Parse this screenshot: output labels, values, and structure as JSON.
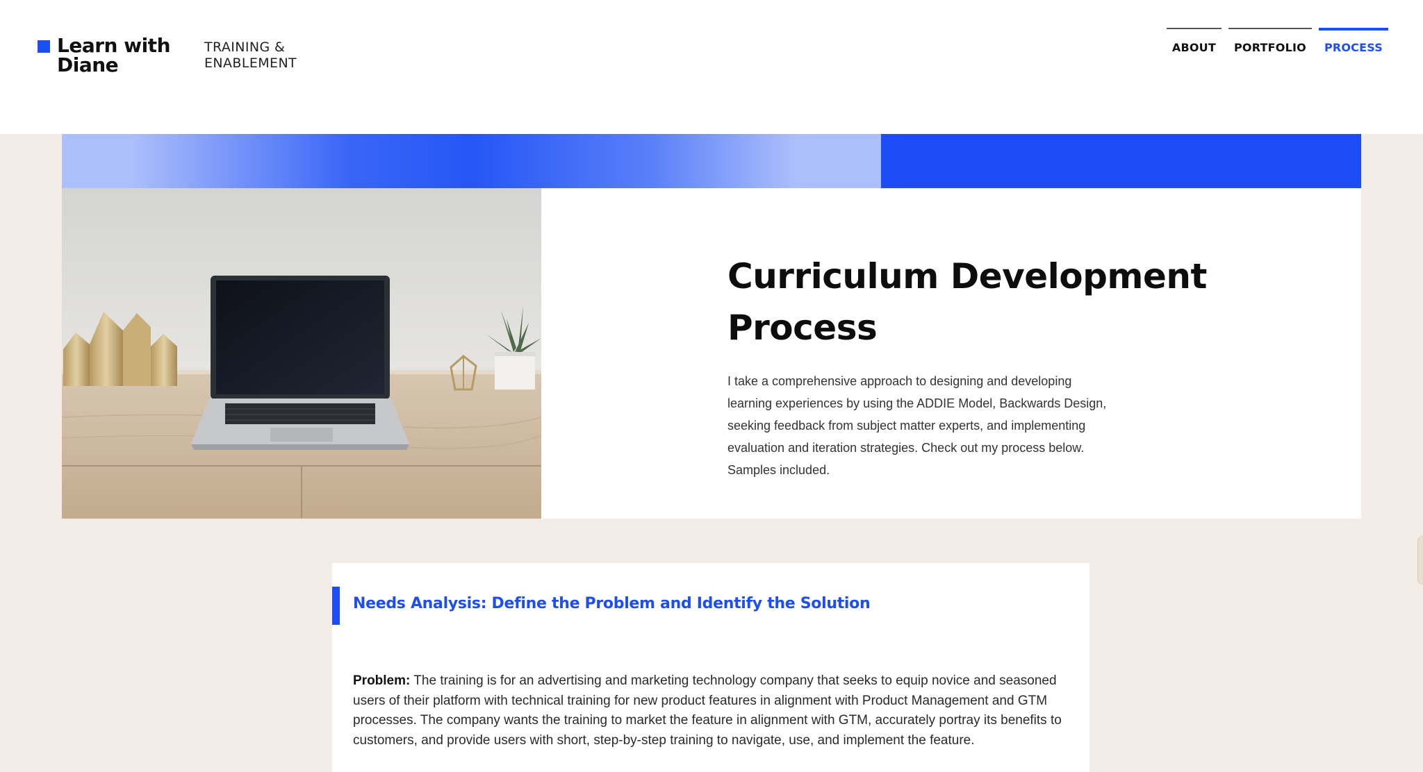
{
  "header": {
    "logo_line1": "Learn with",
    "logo_line2": "Diane",
    "tagline_line1": "TRAINING &",
    "tagline_line2": "ENABLEMENT"
  },
  "nav": {
    "items": [
      {
        "label": "ABOUT",
        "active": false
      },
      {
        "label": "PORTFOLIO",
        "active": false
      },
      {
        "label": "PROCESS",
        "active": true
      }
    ]
  },
  "hero": {
    "title": "Curriculum Development Process",
    "body": "I take a comprehensive approach to designing and developing learning experiences by using the ADDIE Model, Backwards Design, seeking feedback from subject matter experts, and implementing evaluation and iteration strategies. Check out my process below. Samples included.",
    "image_alt": "laptop on wooden desk"
  },
  "section": {
    "title": "Needs Analysis: Define the Problem and Identify the Solution",
    "problem_label": "Problem:",
    "problem_text": "The training is for an advertising and marketing technology company that seeks to equip novice and seasoned users of their platform with technical training for new product features in alignment with Product Management and GTM processes. The company wants the training to market the feature in alignment with GTM, accurately portray its benefits to customers, and provide users with short, step-by-step training to navigate, use, and implement the feature."
  },
  "colors": {
    "accent": "#1d4ef5",
    "background": "#f3ebe6"
  }
}
